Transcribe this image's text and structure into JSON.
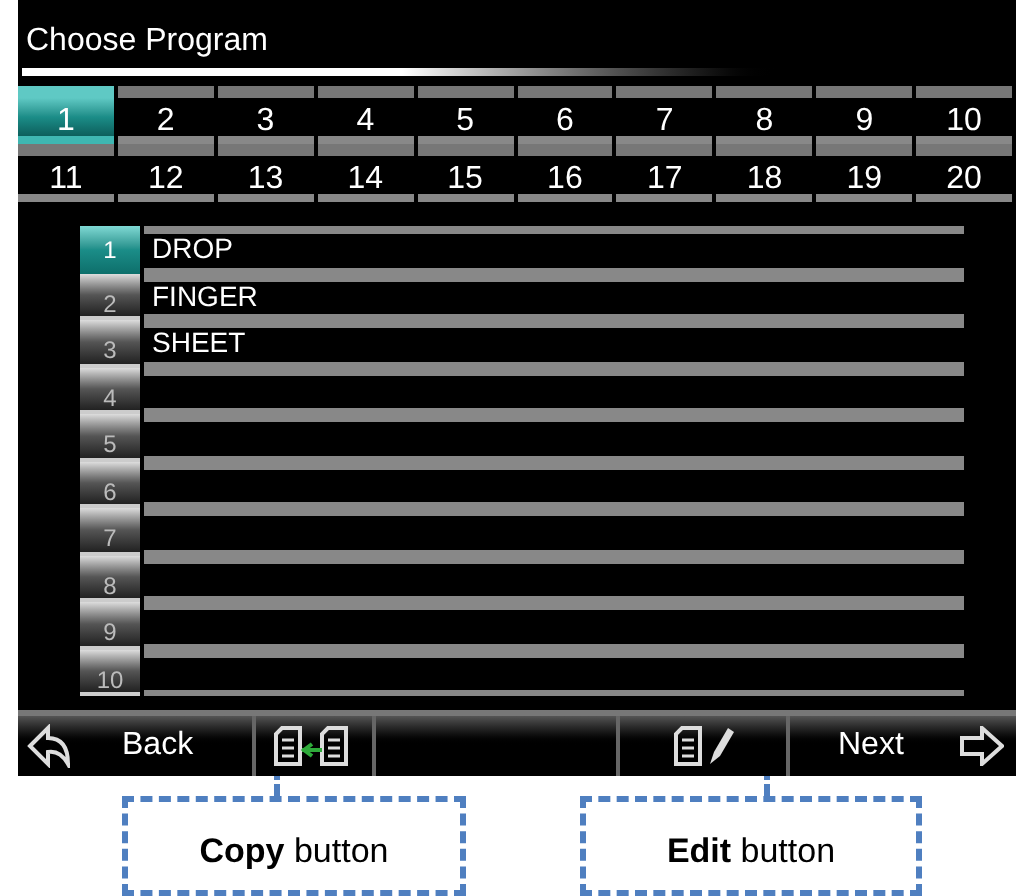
{
  "title": "Choose Program",
  "program_tabs": [
    {
      "label": "1",
      "selected": true
    },
    {
      "label": "2",
      "selected": false
    },
    {
      "label": "3",
      "selected": false
    },
    {
      "label": "4",
      "selected": false
    },
    {
      "label": "5",
      "selected": false
    },
    {
      "label": "6",
      "selected": false
    },
    {
      "label": "7",
      "selected": false
    },
    {
      "label": "8",
      "selected": false
    },
    {
      "label": "9",
      "selected": false
    },
    {
      "label": "10",
      "selected": false
    },
    {
      "label": "11",
      "selected": false
    },
    {
      "label": "12",
      "selected": false
    },
    {
      "label": "13",
      "selected": false
    },
    {
      "label": "14",
      "selected": false
    },
    {
      "label": "15",
      "selected": false
    },
    {
      "label": "16",
      "selected": false
    },
    {
      "label": "17",
      "selected": false
    },
    {
      "label": "18",
      "selected": false
    },
    {
      "label": "19",
      "selected": false
    },
    {
      "label": "20",
      "selected": false
    }
  ],
  "programs": [
    {
      "number": "1",
      "name": "DROP",
      "selected": true
    },
    {
      "number": "2",
      "name": "FINGER",
      "selected": false
    },
    {
      "number": "3",
      "name": "SHEET",
      "selected": false
    },
    {
      "number": "4",
      "selected": false
    },
    {
      "number": "5",
      "selected": false
    },
    {
      "number": "6",
      "selected": false
    },
    {
      "number": "7",
      "selected": false
    },
    {
      "number": "8",
      "selected": false
    },
    {
      "number": "9",
      "selected": false
    },
    {
      "number": "10",
      "selected": false
    }
  ],
  "toolbar": {
    "back": "Back",
    "next": "Next"
  },
  "callouts": [
    {
      "text": "**Copy** button"
    },
    {
      "text": "**Edit** button"
    }
  ]
}
